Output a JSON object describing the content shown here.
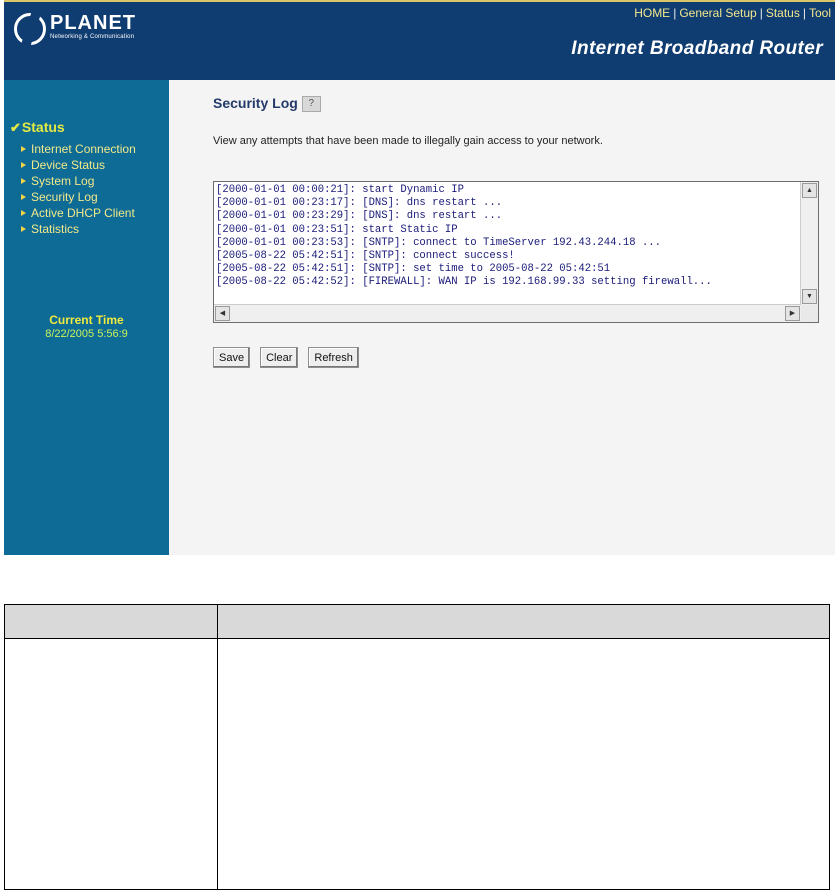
{
  "header": {
    "logo_name": "PLANET",
    "logo_tagline": "Networking & Communication",
    "top_links": [
      "HOME",
      "General Setup",
      "Status",
      "Tool"
    ],
    "brand_title": "Internet Broadband Router"
  },
  "sidebar": {
    "section_label": "Status",
    "items": [
      {
        "label": "Internet Connection"
      },
      {
        "label": "Device Status"
      },
      {
        "label": "System Log"
      },
      {
        "label": "Security Log"
      },
      {
        "label": "Active DHCP Client"
      },
      {
        "label": "Statistics"
      }
    ],
    "current_time_label": "Current Time",
    "current_time_value": "8/22/2005 5:56:9"
  },
  "main": {
    "title": "Security Log",
    "description": "View any attempts that have been made to illegally gain access to your network.",
    "log_lines": [
      "[2000-01-01 00:00:21]: start Dynamic IP",
      "[2000-01-01 00:23:17]: [DNS]: dns restart ...",
      "[2000-01-01 00:23:29]: [DNS]: dns restart ...",
      "[2000-01-01 00:23:51]: start Static IP",
      "[2000-01-01 00:23:53]: [SNTP]: connect to TimeServer 192.43.244.18 ...",
      "[2005-08-22 05:42:51]: [SNTP]: connect success!",
      "[2005-08-22 05:42:51]: [SNTP]: set time to 2005-08-22 05:42:51",
      "[2005-08-22 05:42:52]: [FIREWALL]: WAN IP is 192.168.99.33 setting firewall..."
    ],
    "buttons": {
      "save": "Save",
      "clear": "Clear",
      "refresh": "Refresh"
    }
  },
  "colors": {
    "header_bg": "#0f3c71",
    "sidebar_bg": "#0d6b96",
    "nav_text": "#f2e98a",
    "log_text": "#1a1a7a"
  }
}
